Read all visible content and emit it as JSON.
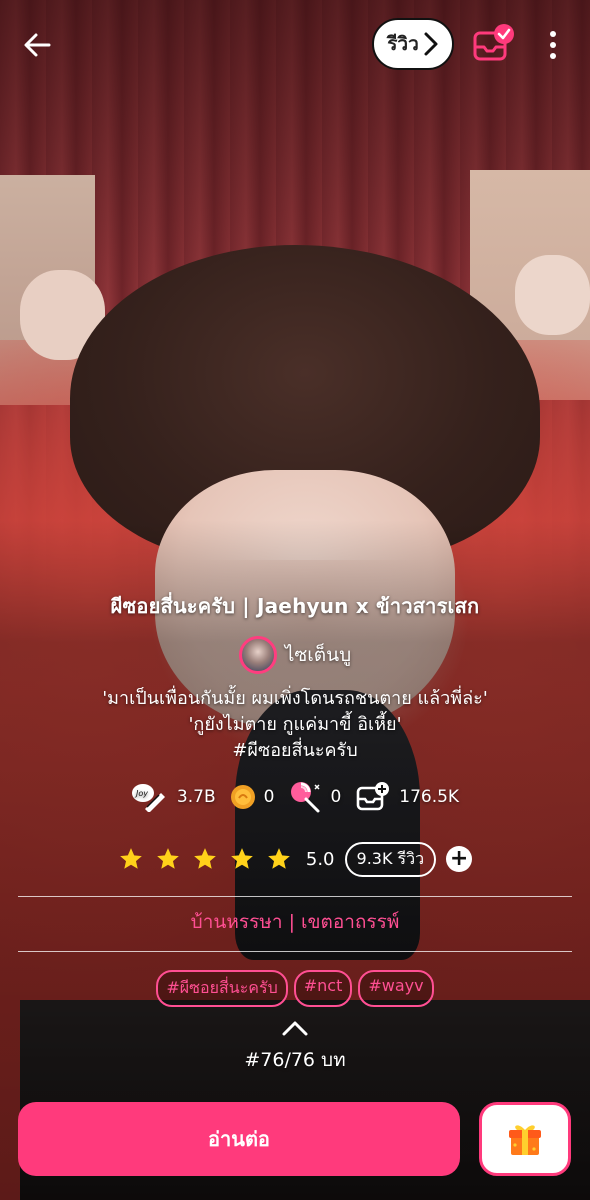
{
  "header": {
    "review_label": "รีวิว"
  },
  "story": {
    "title": "ผีซอยสี่นะครับ | Jaehyun x ข้าวสารเสก",
    "author": "ไซเต็นบู",
    "synopsis_line1": "'มาเป็นเพื่อนกันมั้ย ผมเพิ่งโดนรถชนตาย แล้วพี่ล่ะ'",
    "synopsis_line2": "'กูยังไม่ตาย กูแค่มาขี้ อิเหี้ย'",
    "synopsis_tag": "#ผีซอยสี่นะครับ"
  },
  "stats": {
    "joy": "3.7B",
    "coins": "0",
    "candy": "0",
    "library": "176.5K"
  },
  "rating": {
    "stars": 5,
    "value": "5.0",
    "reviews": "9.3K รีวิว"
  },
  "publishers": {
    "first": "บ้านหรรษา",
    "second": "| เขตอาถรรพ์"
  },
  "tags": [
    "#ผีซอยสี่นะครับ",
    "#nct",
    "#wayv"
  ],
  "chapter": "#76/76 บท",
  "actions": {
    "read_label": "อ่านต่อ"
  },
  "colors": {
    "accent": "#ff3a7c",
    "accent_text": "#ff4f93",
    "star": "#ffd21a"
  },
  "icons": [
    "back-arrow-icon",
    "chevron-right-icon",
    "library-check-icon",
    "more-vertical-icon",
    "joy-pen-icon",
    "coin-icon",
    "candy-icon",
    "library-icon",
    "star-icon",
    "plus-icon",
    "chevron-up-icon",
    "gift-icon"
  ]
}
